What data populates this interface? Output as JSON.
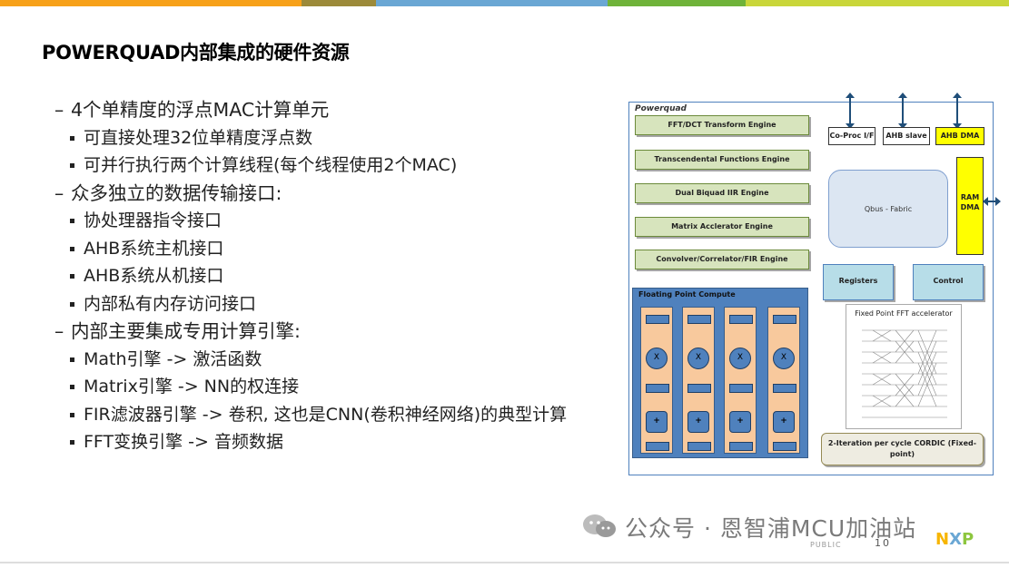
{
  "top_bar": {
    "colors": [
      "#f7a11a",
      "#9c8a3a",
      "#6aa7d4",
      "#6fb33a",
      "#c9d63a"
    ]
  },
  "slide": {
    "title": "POWERQUAD内部集成的硬件资源",
    "bullets": [
      {
        "text": "4个单精度的浮点MAC计算单元",
        "children": [
          "可直接处理32位单精度浮点数",
          "可并行执行两个计算线程(每个线程使用2个MAC)"
        ]
      },
      {
        "text": "众多独立的数据传输接口:",
        "children": [
          "协处理器指令接口",
          "AHB系统主机接口",
          "AHB系统从机接口",
          "内部私有内存访问接口"
        ]
      },
      {
        "text": "内部主要集成专用计算引擎:",
        "children": [
          "Math引擎 -> 激活函数",
          "Matrix引擎 -> NN的权连接",
          "FIR滤波器引擎 -> 卷积, 这也是CNN(卷积神经网络)的典型计算",
          "FFT变换引擎 -> 音频数据"
        ]
      }
    ]
  },
  "diagram": {
    "label": "Powerquad",
    "engines": [
      "FFT/DCT Transform Engine",
      "Transcendental Functions Engine",
      "Dual Biquad IIR Engine",
      "Matrix Acclerator Engine",
      "Convolver/Correlator/FIR Engine"
    ],
    "interfaces": [
      "Co-Proc I/F",
      "AHB slave",
      "AHB DMA"
    ],
    "qbus": "Qbus - Fabric",
    "ram_dma": [
      "RAM",
      "DMA"
    ],
    "registers": "Registers",
    "control": "Control",
    "fp_compute": "Floating Point Compute",
    "multiply_symbol": "X",
    "add_symbol": "+",
    "fft_accel": "Fixed Point FFT accelerator",
    "cordic": "2-Iteration per cycle CORDIC (Fixed-point)",
    "colors": {
      "engine": "#d7e4bd",
      "yellow": "#ffff00",
      "blue": "#4f81bd",
      "orange": "#f8c99d"
    }
  },
  "footer": {
    "watermark": "公众号 · 恩智浦MCU加油站",
    "public": "PUBLIC",
    "page_number": "10",
    "logo": [
      "N",
      "X",
      "P"
    ],
    "logo_colors": [
      "#f7b500",
      "#6aa7d4",
      "#8dc63f"
    ]
  }
}
